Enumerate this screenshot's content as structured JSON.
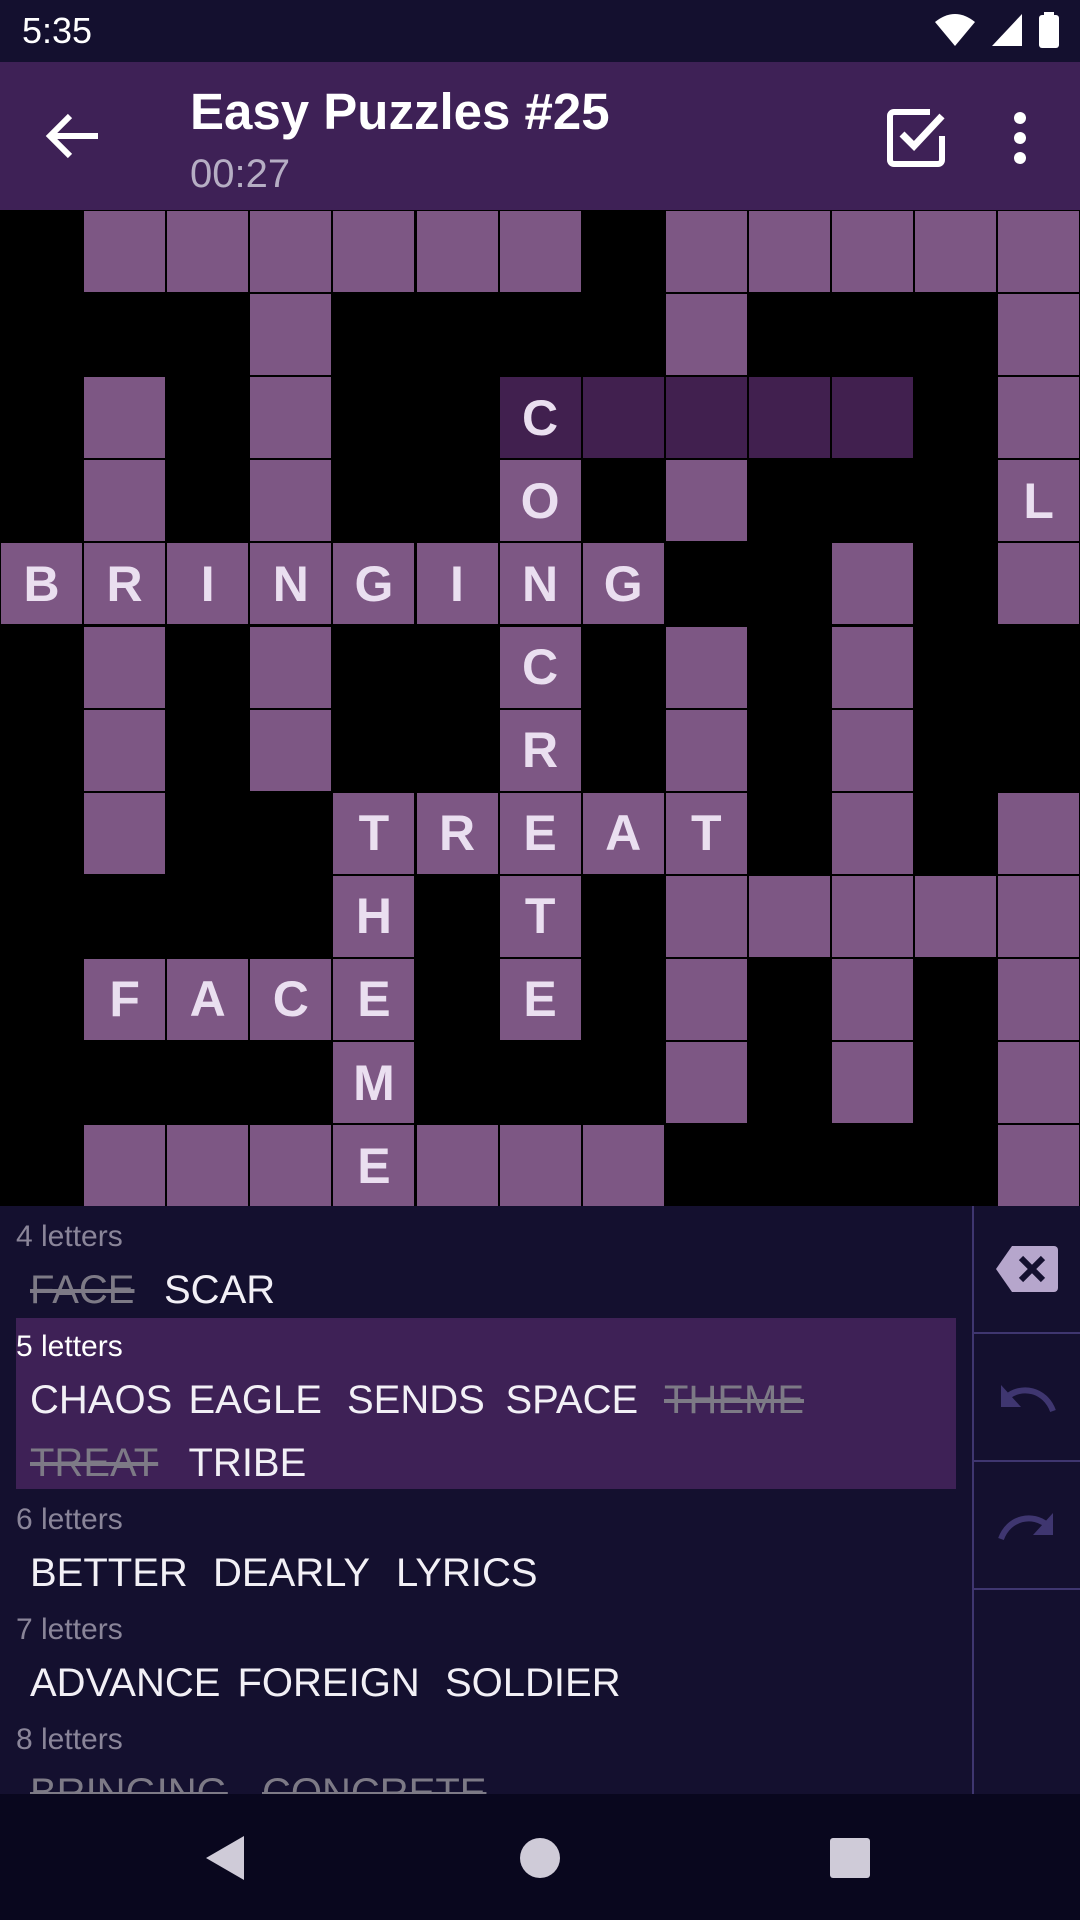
{
  "status_bar": {
    "time": "5:35",
    "icons": [
      "wifi-icon",
      "cellular-signal-icon",
      "battery-icon"
    ]
  },
  "app_bar": {
    "title": "Easy Puzzles #25",
    "timer": "00:27",
    "icons": {
      "back": "arrow-left-icon",
      "check": "check-box-icon",
      "more": "more-vert-icon"
    }
  },
  "grid": {
    "rows": 12,
    "cols": 13,
    "cells": [
      [
        0,
        1,
        ""
      ],
      [
        0,
        2,
        ""
      ],
      [
        0,
        3,
        ""
      ],
      [
        0,
        4,
        ""
      ],
      [
        0,
        5,
        ""
      ],
      [
        0,
        6,
        ""
      ],
      [
        0,
        8,
        ""
      ],
      [
        0,
        9,
        ""
      ],
      [
        0,
        10,
        ""
      ],
      [
        0,
        11,
        ""
      ],
      [
        0,
        12,
        ""
      ],
      [
        1,
        3,
        ""
      ],
      [
        1,
        8,
        ""
      ],
      [
        1,
        12,
        ""
      ],
      [
        2,
        1,
        ""
      ],
      [
        2,
        3,
        ""
      ],
      [
        2,
        6,
        "C",
        "sel"
      ],
      [
        2,
        7,
        "",
        "sel"
      ],
      [
        2,
        8,
        "",
        "sel"
      ],
      [
        2,
        9,
        "",
        "sel"
      ],
      [
        2,
        10,
        "",
        "sel"
      ],
      [
        2,
        12,
        ""
      ],
      [
        3,
        1,
        ""
      ],
      [
        3,
        3,
        ""
      ],
      [
        3,
        6,
        "O"
      ],
      [
        3,
        8,
        ""
      ],
      [
        3,
        12,
        "L"
      ],
      [
        4,
        0,
        "B"
      ],
      [
        4,
        1,
        "R"
      ],
      [
        4,
        2,
        "I"
      ],
      [
        4,
        3,
        "N"
      ],
      [
        4,
        4,
        "G"
      ],
      [
        4,
        5,
        "I"
      ],
      [
        4,
        6,
        "N"
      ],
      [
        4,
        7,
        "G"
      ],
      [
        4,
        10,
        ""
      ],
      [
        4,
        12,
        ""
      ],
      [
        5,
        1,
        ""
      ],
      [
        5,
        3,
        ""
      ],
      [
        5,
        6,
        "C"
      ],
      [
        5,
        8,
        ""
      ],
      [
        5,
        10,
        ""
      ],
      [
        6,
        1,
        ""
      ],
      [
        6,
        3,
        ""
      ],
      [
        6,
        6,
        "R"
      ],
      [
        6,
        8,
        ""
      ],
      [
        6,
        10,
        ""
      ],
      [
        7,
        1,
        ""
      ],
      [
        7,
        4,
        "T"
      ],
      [
        7,
        5,
        "R"
      ],
      [
        7,
        6,
        "E"
      ],
      [
        7,
        7,
        "A"
      ],
      [
        7,
        8,
        "T"
      ],
      [
        7,
        10,
        ""
      ],
      [
        7,
        12,
        ""
      ],
      [
        8,
        4,
        "H"
      ],
      [
        8,
        6,
        "T"
      ],
      [
        8,
        8,
        ""
      ],
      [
        8,
        9,
        ""
      ],
      [
        8,
        10,
        ""
      ],
      [
        8,
        11,
        ""
      ],
      [
        8,
        12,
        ""
      ],
      [
        9,
        1,
        "F"
      ],
      [
        9,
        2,
        "A"
      ],
      [
        9,
        3,
        "C"
      ],
      [
        9,
        4,
        "E"
      ],
      [
        9,
        6,
        "E"
      ],
      [
        9,
        8,
        ""
      ],
      [
        9,
        10,
        ""
      ],
      [
        9,
        12,
        ""
      ],
      [
        10,
        4,
        "M"
      ],
      [
        10,
        8,
        ""
      ],
      [
        10,
        10,
        ""
      ],
      [
        10,
        12,
        ""
      ],
      [
        11,
        1,
        ""
      ],
      [
        11,
        2,
        ""
      ],
      [
        11,
        3,
        ""
      ],
      [
        11,
        4,
        "E"
      ],
      [
        11,
        5,
        ""
      ],
      [
        11,
        6,
        ""
      ],
      [
        11,
        7,
        ""
      ],
      [
        11,
        12,
        ""
      ]
    ]
  },
  "word_groups": [
    {
      "label": "4 letters",
      "words": [
        {
          "text": "FACE",
          "used": true
        },
        {
          "text": "SCAR",
          "used": false
        }
      ]
    },
    {
      "label": "5 letters",
      "highlighted": true,
      "words": [
        {
          "text": "CHAOS",
          "used": false
        },
        {
          "text": "EAGLE",
          "used": false
        },
        {
          "text": "SENDS",
          "used": false
        },
        {
          "text": "SPACE",
          "used": false
        },
        {
          "text": "THEME",
          "used": true
        },
        {
          "text": "TREAT",
          "used": true
        },
        {
          "text": "TRIBE",
          "used": false
        }
      ]
    },
    {
      "label": "6 letters",
      "words": [
        {
          "text": "BETTER",
          "used": false
        },
        {
          "text": "DEARLY",
          "used": false
        },
        {
          "text": "LYRICS",
          "used": false
        }
      ]
    },
    {
      "label": "7 letters",
      "words": [
        {
          "text": "ADVANCE",
          "used": false
        },
        {
          "text": "FOREIGN",
          "used": false
        },
        {
          "text": "SOLDIER",
          "used": false
        }
      ]
    },
    {
      "label": "8 letters",
      "words": [
        {
          "text": "BRINGING",
          "used": true
        },
        {
          "text": "CONCRETE",
          "used": true
        }
      ]
    }
  ],
  "side_controls": {
    "delete": "backspace-icon",
    "undo": "undo-icon",
    "redo": "redo-icon"
  },
  "nav_bar": {
    "back": "nav-back-icon",
    "home": "nav-home-icon",
    "recents": "nav-recents-icon"
  }
}
